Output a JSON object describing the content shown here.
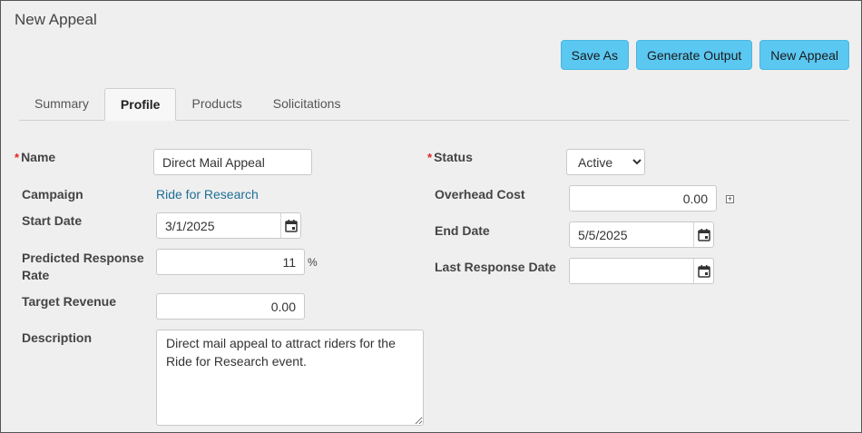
{
  "page": {
    "title": "New Appeal"
  },
  "actions": {
    "save_as": "Save As",
    "generate_output": "Generate Output",
    "new_appeal": "New Appeal"
  },
  "tabs": [
    {
      "label": "Summary",
      "active": false
    },
    {
      "label": "Profile",
      "active": true
    },
    {
      "label": "Products",
      "active": false
    },
    {
      "label": "Solicitations",
      "active": false
    }
  ],
  "form": {
    "required_marker": "*",
    "name": {
      "label": "Name",
      "value": "Direct Mail Appeal"
    },
    "campaign": {
      "label": "Campaign",
      "value": "Ride for Research"
    },
    "start_date": {
      "label": "Start Date",
      "value": "3/1/2025"
    },
    "predicted_response_rate": {
      "label": "Predicted Response Rate",
      "value": "11",
      "unit": "%"
    },
    "target_revenue": {
      "label": "Target Revenue",
      "value": "0.00"
    },
    "description": {
      "label": "Description",
      "value": "Direct mail appeal to attract riders for the Ride for Research event."
    },
    "status": {
      "label": "Status",
      "value": "Active",
      "options": [
        "Active"
      ]
    },
    "overhead_cost": {
      "label": "Overhead Cost",
      "value": "0.00",
      "expand_symbol": "+"
    },
    "end_date": {
      "label": "End Date",
      "value": "5/5/2025"
    },
    "last_response_date": {
      "label": "Last Response Date",
      "value": ""
    }
  },
  "icons": {
    "calendar": "calendar-icon",
    "expand": "expand-icon"
  }
}
